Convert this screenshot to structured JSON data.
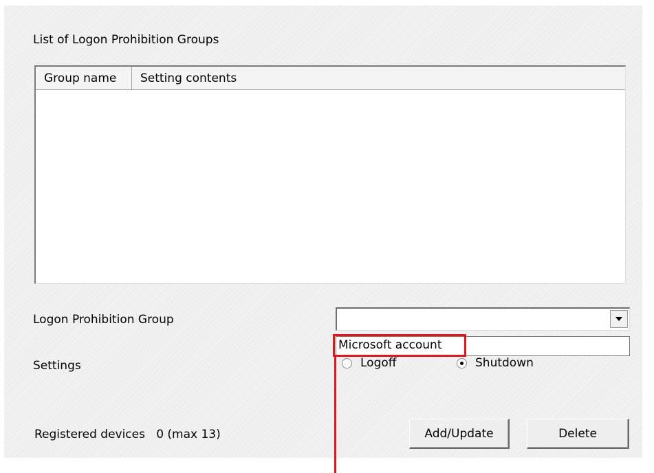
{
  "section": {
    "title": "List of Logon Prohibition Groups"
  },
  "list": {
    "columns": [
      "Group name",
      "Setting contents"
    ],
    "rows": []
  },
  "form": {
    "group_label": "Logon Prohibition Group",
    "group_value": "",
    "dropdown_item": "Microsoft account",
    "settings_label": "Settings",
    "settings_options": [
      {
        "label": "Logoff",
        "selected": false
      },
      {
        "label": "Shutdown",
        "selected": true
      }
    ]
  },
  "footer": {
    "registered_label": "Registered devices",
    "registered_value": "0 (max 13)",
    "add_update_label": "Add/Update",
    "delete_label": "Delete"
  },
  "colors": {
    "highlight": "#e0161e",
    "panel_bg": "#ececec"
  },
  "icons": {
    "combo_arrow": "chevron-down-icon"
  }
}
